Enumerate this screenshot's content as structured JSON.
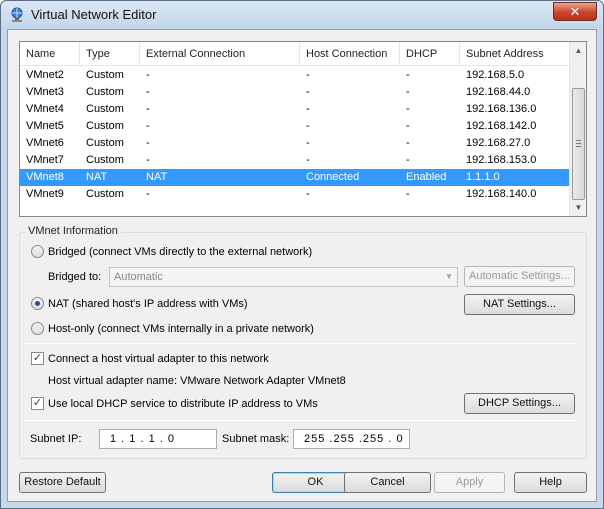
{
  "window": {
    "title": "Virtual Network Editor",
    "close_glyph": "✕"
  },
  "table": {
    "headers": [
      "Name",
      "Type",
      "External Connection",
      "Host Connection",
      "DHCP",
      "Subnet Address"
    ],
    "rows": [
      [
        "VMnet2",
        "Custom",
        "-",
        "-",
        "-",
        "192.168.5.0"
      ],
      [
        "VMnet3",
        "Custom",
        "-",
        "-",
        "-",
        "192.168.44.0"
      ],
      [
        "VMnet4",
        "Custom",
        "-",
        "-",
        "-",
        "192.168.136.0"
      ],
      [
        "VMnet5",
        "Custom",
        "-",
        "-",
        "-",
        "192.168.142.0"
      ],
      [
        "VMnet6",
        "Custom",
        "-",
        "-",
        "-",
        "192.168.27.0"
      ],
      [
        "VMnet7",
        "Custom",
        "-",
        "-",
        "-",
        "192.168.153.0"
      ],
      [
        "VMnet8",
        "NAT",
        "NAT",
        "Connected",
        "Enabled",
        "1.1.1.0"
      ],
      [
        "VMnet9",
        "Custom",
        "-",
        "-",
        "-",
        "192.168.140.0"
      ]
    ],
    "selected_index": 6
  },
  "vmnet_info": {
    "group_label": "VMnet Information",
    "bridged_label": "Bridged (connect VMs directly to the external network)",
    "bridged_to_label": "Bridged to:",
    "bridged_to_value": "Automatic",
    "automatic_settings_button": "Automatic Settings...",
    "nat_label": "NAT (shared host's IP address with VMs)",
    "nat_settings_button": "NAT Settings...",
    "hostonly_label": "Host-only (connect VMs internally in a private network)",
    "connection_mode": "nat",
    "connect_adapter_label": "Connect a host virtual adapter to this network",
    "connect_adapter_checked": true,
    "adapter_name_label": "Host virtual adapter name: VMware Network Adapter VMnet8",
    "use_dhcp_label": "Use local DHCP service to distribute IP address to VMs",
    "use_dhcp_checked": true,
    "dhcp_settings_button": "DHCP Settings...",
    "subnet_ip_label": "Subnet IP:",
    "subnet_ip_value": "1  .  1  .  1  .  0",
    "subnet_mask_label": "Subnet mask:",
    "subnet_mask_value": "255 .255 .255 . 0"
  },
  "footer": {
    "restore_default": "Restore Default",
    "ok": "OK",
    "cancel": "Cancel",
    "apply": "Apply",
    "help": "Help"
  },
  "colors": {
    "selection": "#3399ff",
    "title_bar": "#c7d8ea",
    "close_button": "#c9442a"
  }
}
